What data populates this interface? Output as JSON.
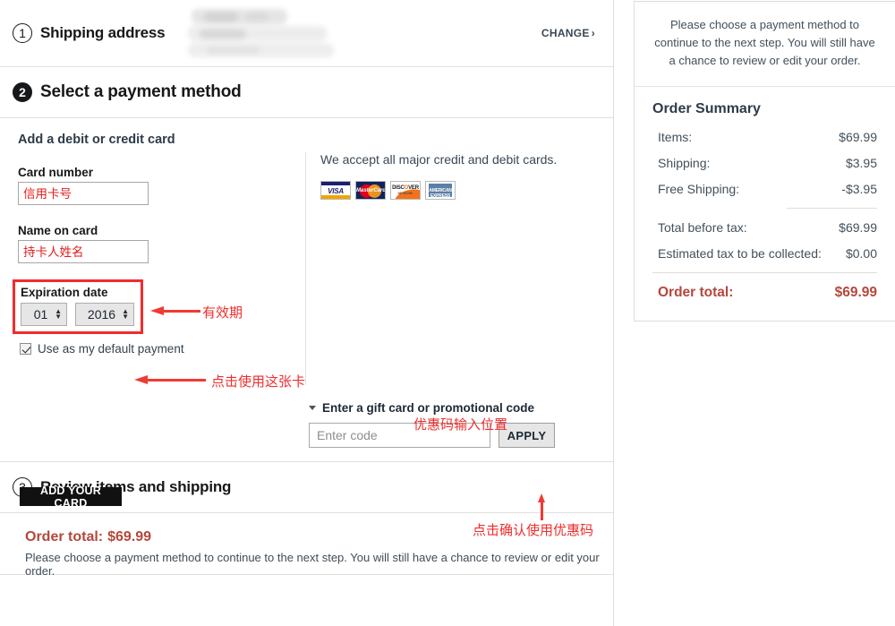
{
  "steps": {
    "shipping": {
      "number": "1",
      "title": "Shipping address",
      "change_label": "CHANGE",
      "chevron": "›"
    },
    "payment": {
      "number": "2",
      "title": "Select a payment method"
    },
    "review": {
      "number": "3",
      "title": "Review items and shipping"
    }
  },
  "payment": {
    "add_card_heading": "Add a debit or credit card",
    "card_number_label": "Card number",
    "card_number_placeholder": "信用卡号",
    "name_on_card_label": "Name on card",
    "name_on_card_placeholder": "持卡人姓名",
    "expiration_label": "Expiration date",
    "expiration_month": "01",
    "expiration_year": "2016",
    "default_payment_label": "Use as my default payment",
    "add_card_button": "ADD YOUR CARD",
    "accept_text": "We accept all major credit and debit cards.",
    "card_logos": [
      {
        "name": "visa-logo",
        "text": "VISA"
      },
      {
        "name": "mastercard-logo",
        "text": "MasterCard"
      },
      {
        "name": "discover-logo",
        "text": "DISCOVER",
        "sub": "NETWORK"
      },
      {
        "name": "amex-logo",
        "text": "AMERICAN EXPRESS"
      }
    ]
  },
  "gift": {
    "title": "Enter a gift card or promotional code",
    "code_placeholder": "Enter code",
    "apply_label": "APPLY"
  },
  "review_total": {
    "label": "Order total:",
    "amount": "$69.99",
    "note": "Please choose a payment method to continue to the next step. You will still have a chance to review or edit your order."
  },
  "sidebar": {
    "note": "Please choose a payment method to continue to the next step. You will still have a chance to review or edit your order.",
    "summary_title": "Order Summary",
    "rows": [
      {
        "label": "Items:",
        "value": "$69.99"
      },
      {
        "label": "Shipping:",
        "value": "$3.95"
      },
      {
        "label": "Free Shipping:",
        "value": "-$3.95"
      },
      {
        "label": "Total before tax:",
        "value": "$69.99"
      },
      {
        "label": "Estimated tax to be collected:",
        "value": "$0.00"
      }
    ],
    "total": {
      "label": "Order total:",
      "value": "$69.99"
    }
  },
  "annotations": [
    {
      "name": "expiration-annotation",
      "text": "有效期"
    },
    {
      "name": "add-card-annotation",
      "text": "点击使用这张卡"
    },
    {
      "name": "code-input-annotation",
      "text": "优惠码输入位置"
    },
    {
      "name": "apply-annotation",
      "text": "点击确认使用优惠码"
    }
  ],
  "colors": {
    "annotation_red": "#ef2d2d",
    "order_total_red": "#b5473c",
    "dark": "#17181a"
  }
}
